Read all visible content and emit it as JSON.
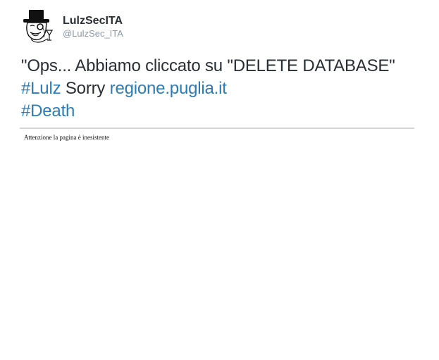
{
  "tweet": {
    "author": {
      "display_name": "LulzSecITA",
      "screen_name": "@LulzSec_ITA",
      "avatar_icon": "lulzsec-monocle-tophat-avatar-icon"
    },
    "text": {
      "part1": "\"Ops... Abbiamo cliccato su \"DELETE DATABASE\" ",
      "hashtag1": "#Lulz",
      "part2": " Sorry ",
      "link": "regione.puglia.it",
      "part3": " ",
      "hashtag2": "#Death"
    },
    "media": {
      "caption": "Attenzione la pagina è inesistente"
    }
  },
  "colors": {
    "text": "#292f33",
    "muted": "#8899a6",
    "link": "#2b7bb9",
    "divider": "#d6d6d6"
  }
}
